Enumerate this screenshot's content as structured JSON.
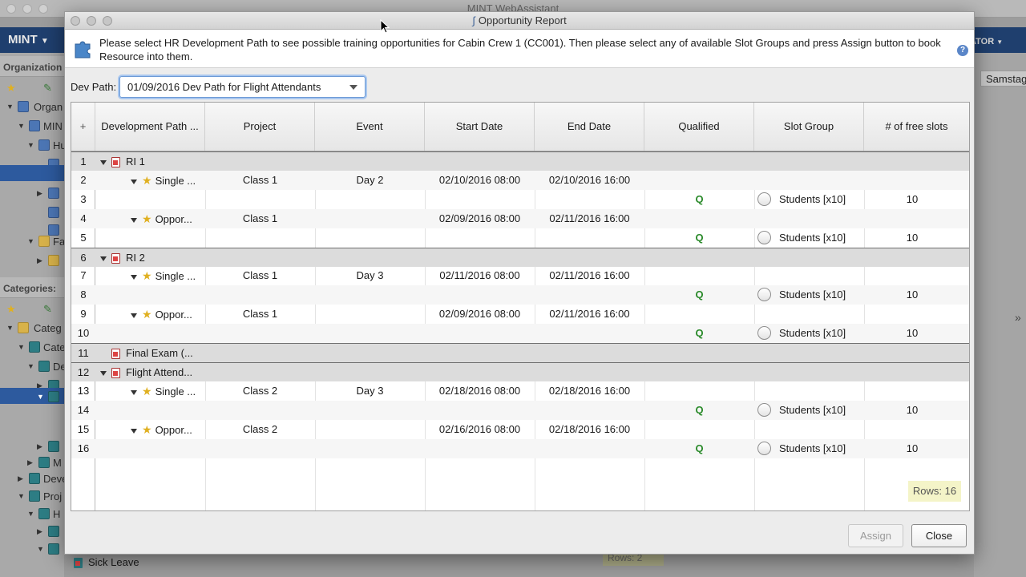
{
  "background_app": {
    "title": "MINT WebAssistant",
    "menu_label": "MINT",
    "right_menu_label": "ATOR",
    "sidebar_sections": {
      "organization": "Organization",
      "categories": "Categories:"
    },
    "tree_labels": [
      "Organ",
      "MIN",
      "Hu",
      "Fa",
      "Categ",
      "Cate",
      "De",
      "M",
      "Deve",
      "Proj",
      "H"
    ],
    "right_column_header": "Samstag",
    "bottom_label": "Sick Leave",
    "bottom_rows": "Rows: 2"
  },
  "dialog": {
    "title": "Opportunity Report",
    "info_text": "Please select HR Development Path to see possible training opportunities for Cabin Crew 1 (CC001). Then please select any of available Slot Groups and press Assign button to book Resource into them.",
    "help_icon_text": "?",
    "dev_path_label": "Dev Path:",
    "dev_path_value": "01/09/2016 Dev Path for Flight Attendants",
    "columns": {
      "add": "+",
      "dev_path": "Development Path ...",
      "project": "Project",
      "event": "Event",
      "start_date": "Start Date",
      "end_date": "End Date",
      "qualified": "Qualified",
      "slot_group": "Slot Group",
      "free_slots": "# of free slots"
    },
    "rows": [
      {
        "num": "1",
        "kind": "group",
        "label": "RI 1"
      },
      {
        "num": "2",
        "kind": "item",
        "label": "Single ...",
        "project": "Class 1",
        "event": "Day 2",
        "start": "02/10/2016 08:00",
        "end": "02/10/2016 16:00"
      },
      {
        "num": "3",
        "kind": "slot",
        "qualified": "Q",
        "slot": "Students [x10]",
        "free": "10"
      },
      {
        "num": "4",
        "kind": "item",
        "label": "Oppor...",
        "project": "Class 1",
        "event": "",
        "start": "02/09/2016 08:00",
        "end": "02/11/2016 16:00"
      },
      {
        "num": "5",
        "kind": "slot",
        "qualified": "Q",
        "slot": "Students [x10]",
        "free": "10"
      },
      {
        "num": "6",
        "kind": "group",
        "label": "RI 2"
      },
      {
        "num": "7",
        "kind": "item",
        "label": "Single ...",
        "project": "Class 1",
        "event": "Day 3",
        "start": "02/11/2016 08:00",
        "end": "02/11/2016 16:00"
      },
      {
        "num": "8",
        "kind": "slot",
        "qualified": "Q",
        "slot": "Students [x10]",
        "free": "10"
      },
      {
        "num": "9",
        "kind": "item",
        "label": "Oppor...",
        "project": "Class 1",
        "event": "",
        "start": "02/09/2016 08:00",
        "end": "02/11/2016 16:00"
      },
      {
        "num": "10",
        "kind": "slot",
        "qualified": "Q",
        "slot": "Students [x10]",
        "free": "10"
      },
      {
        "num": "11",
        "kind": "group-leaf",
        "label": "Final Exam (..."
      },
      {
        "num": "12",
        "kind": "group",
        "label": "Flight Attend..."
      },
      {
        "num": "13",
        "kind": "item",
        "label": "Single ...",
        "project": "Class 2",
        "event": "Day 3",
        "start": "02/18/2016 08:00",
        "end": "02/18/2016 16:00"
      },
      {
        "num": "14",
        "kind": "slot",
        "qualified": "Q",
        "slot": "Students [x10]",
        "free": "10"
      },
      {
        "num": "15",
        "kind": "item",
        "label": "Oppor...",
        "project": "Class 2",
        "event": "",
        "start": "02/16/2016 08:00",
        "end": "02/18/2016 16:00"
      },
      {
        "num": "16",
        "kind": "slot",
        "qualified": "Q",
        "slot": "Students [x10]",
        "free": "10"
      }
    ],
    "rows_count": "Rows: 16",
    "assign_label": "Assign",
    "close_label": "Close"
  },
  "colors": {
    "menubar": "#1f3f6e",
    "qualified_green": "#2a8a2a",
    "focus_blue": "#6d9bd6",
    "rows_badge": "#f4f4c8"
  }
}
